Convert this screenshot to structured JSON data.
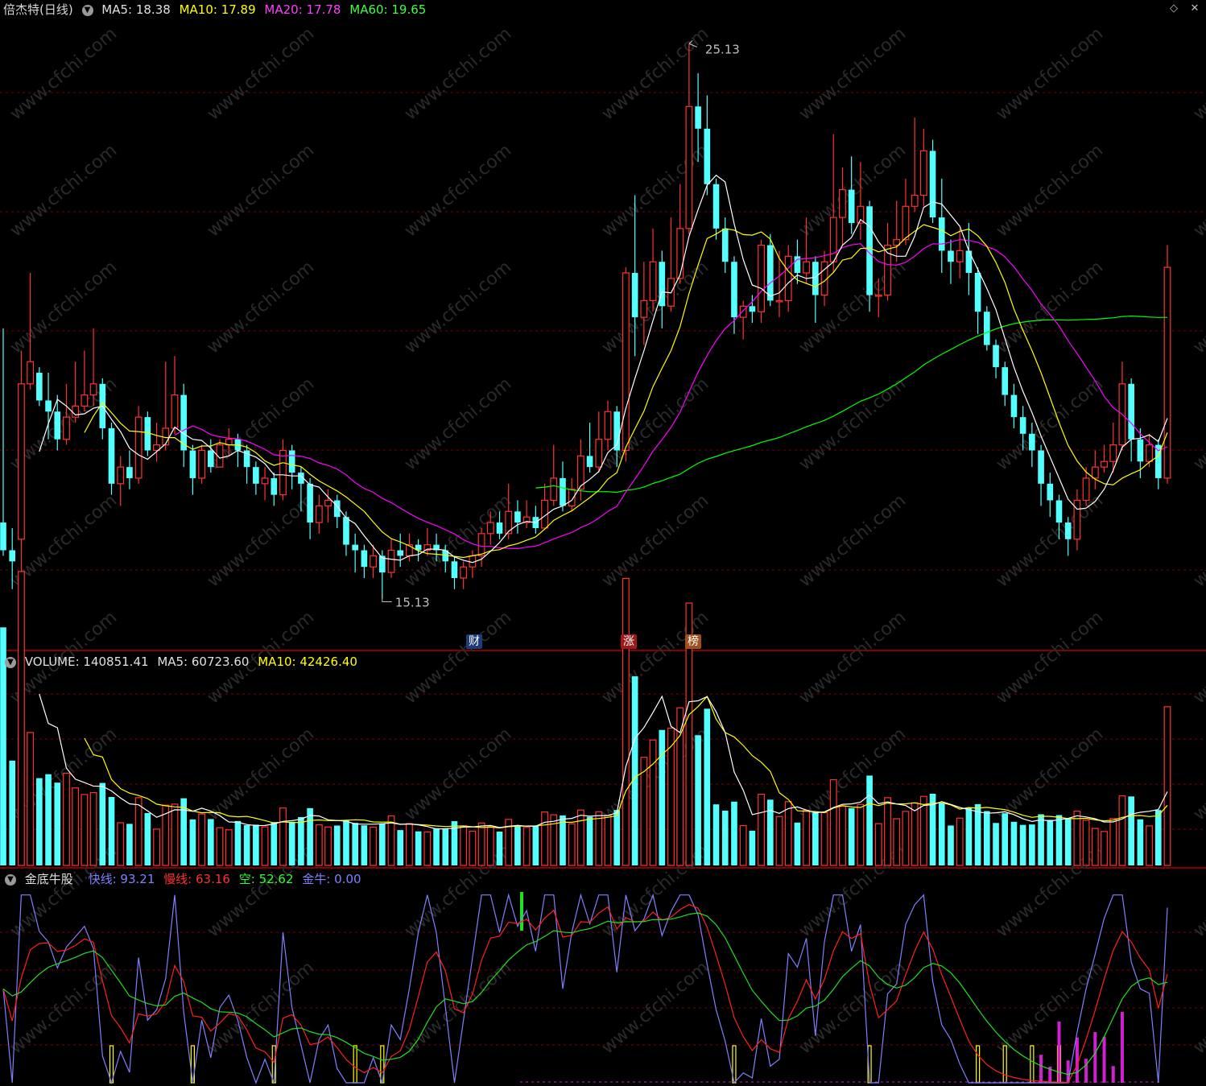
{
  "header": {
    "stock_name": "倍杰特(日线)",
    "ma5": "MA5: 18.38",
    "ma10": "MA10: 17.89",
    "ma20": "MA20: 17.78",
    "ma60": "MA60: 19.65"
  },
  "volume_header": {
    "volume": "VOLUME: 140851.41",
    "ma5": "MA5: 60723.60",
    "ma10": "MA10: 42426.40"
  },
  "indicator_header": {
    "name": "金底牛股",
    "fast_label": "快线:",
    "fast_value": "93.21",
    "slow_label": "慢线:",
    "slow_value": "63.16",
    "empty_label": "空:",
    "empty_value": "52.62",
    "bull_label": "金牛:",
    "bull_value": "0.00"
  },
  "price_labels": {
    "high": "25.13",
    "low": "15.13"
  },
  "event_tags": [
    "财",
    "涨",
    "榜"
  ],
  "watermark": "www.cfchi.com",
  "colors": {
    "up": "#ff3232",
    "down": "#54ffff",
    "ma5": "#ffffff",
    "ma10": "#ffff00",
    "ma20": "#ff00ff",
    "ma60": "#00ff00",
    "grid": "#7a0000",
    "text": "#c0c0c0",
    "fast": "#8080ff",
    "slow": "#ff2020",
    "empty": "#20e020",
    "bull": "#ffff00"
  },
  "chart_data": [
    {
      "type": "candlestick",
      "title": "倍杰特(日线)",
      "max_label": 25.13,
      "min_label": 15.13,
      "candles": [
        [
          16.5,
          16.0,
          20.0,
          15.9
        ],
        [
          16.0,
          15.8,
          16.4,
          15.3
        ],
        [
          16.2,
          19.0,
          19.6,
          15.6
        ],
        [
          19.0,
          19.4,
          21.0,
          18.9
        ],
        [
          19.2,
          18.7,
          19.3,
          18.6
        ],
        [
          18.7,
          18.5,
          19.2,
          18.0
        ],
        [
          18.5,
          18.0,
          18.8,
          17.8
        ],
        [
          18.0,
          18.4,
          19.0,
          17.9
        ],
        [
          18.4,
          18.6,
          19.4,
          18.3
        ],
        [
          18.6,
          18.8,
          19.6,
          18.5
        ],
        [
          18.8,
          19.0,
          20.0,
          18.6
        ],
        [
          19.0,
          18.2,
          19.1,
          18.0
        ],
        [
          18.2,
          17.2,
          18.3,
          17.0
        ],
        [
          17.2,
          17.5,
          17.7,
          16.8
        ],
        [
          17.5,
          17.3,
          17.8,
          17.1
        ],
        [
          17.3,
          18.4,
          18.6,
          17.2
        ],
        [
          18.4,
          17.8,
          18.5,
          17.7
        ],
        [
          17.8,
          17.9,
          18.3,
          17.6
        ],
        [
          17.9,
          18.2,
          19.4,
          17.8
        ],
        [
          18.2,
          18.8,
          19.5,
          18.1
        ],
        [
          18.8,
          17.8,
          19.0,
          17.5
        ],
        [
          17.8,
          17.3,
          17.9,
          17.0
        ],
        [
          17.3,
          17.8,
          17.9,
          17.2
        ],
        [
          17.8,
          17.5,
          18.0,
          17.4
        ],
        [
          17.5,
          17.9,
          18.0,
          17.5
        ],
        [
          17.9,
          18.0,
          18.2,
          17.7
        ],
        [
          18.0,
          17.8,
          18.1,
          17.5
        ],
        [
          17.8,
          17.5,
          17.9,
          17.2
        ],
        [
          17.5,
          17.2,
          17.6,
          17.0
        ],
        [
          17.2,
          17.3,
          17.5,
          16.9
        ],
        [
          17.3,
          17.0,
          17.4,
          16.8
        ],
        [
          17.0,
          17.8,
          18.0,
          16.9
        ],
        [
          17.8,
          17.4,
          17.9,
          17.1
        ],
        [
          17.4,
          17.2,
          17.5,
          16.7
        ],
        [
          17.2,
          16.5,
          17.3,
          16.2
        ],
        [
          16.5,
          16.8,
          17.0,
          16.3
        ],
        [
          16.8,
          16.9,
          17.1,
          16.5
        ],
        [
          16.9,
          16.6,
          17.0,
          16.4
        ],
        [
          16.6,
          16.1,
          16.7,
          15.9
        ],
        [
          16.1,
          16.0,
          16.3,
          15.6
        ],
        [
          16.0,
          15.7,
          16.1,
          15.5
        ],
        [
          15.7,
          15.9,
          16.1,
          15.5
        ],
        [
          15.9,
          15.6,
          16.0,
          15.13
        ],
        [
          15.6,
          16.0,
          16.2,
          15.5
        ],
        [
          16.0,
          15.9,
          16.3,
          15.7
        ],
        [
          15.9,
          16.1,
          16.3,
          15.8
        ],
        [
          16.1,
          16.0,
          16.2,
          15.8
        ],
        [
          16.0,
          16.1,
          16.4,
          15.9
        ],
        [
          16.1,
          16.0,
          16.3,
          15.8
        ],
        [
          16.0,
          15.8,
          16.1,
          15.6
        ],
        [
          15.8,
          15.5,
          15.9,
          15.3
        ],
        [
          15.5,
          15.7,
          15.8,
          15.3
        ],
        [
          15.7,
          15.9,
          16.0,
          15.5
        ],
        [
          15.9,
          16.3,
          16.4,
          15.7
        ],
        [
          16.3,
          16.5,
          16.7,
          16.1
        ],
        [
          16.5,
          16.3,
          16.7,
          16.2
        ],
        [
          16.3,
          16.7,
          17.2,
          16.2
        ],
        [
          16.7,
          16.5,
          16.9,
          16.3
        ],
        [
          16.5,
          16.6,
          16.9,
          16.4
        ],
        [
          16.6,
          16.4,
          16.8,
          16.3
        ],
        [
          16.4,
          16.9,
          17.2,
          16.4
        ],
        [
          16.9,
          17.3,
          17.9,
          16.8
        ],
        [
          17.3,
          16.8,
          17.6,
          16.7
        ],
        [
          16.8,
          17.1,
          17.3,
          16.7
        ],
        [
          17.1,
          17.7,
          18.0,
          16.9
        ],
        [
          17.7,
          17.5,
          18.3,
          17.4
        ],
        [
          17.5,
          18.0,
          18.5,
          17.4
        ],
        [
          18.0,
          18.5,
          18.7,
          17.8
        ],
        [
          18.5,
          17.8,
          18.6,
          17.5
        ],
        [
          17.8,
          21.0,
          21.1,
          17.6
        ],
        [
          21.0,
          20.2,
          22.4,
          19.5
        ],
        [
          20.2,
          20.5,
          21.2,
          19.7
        ],
        [
          20.5,
          21.2,
          21.8,
          20.3
        ],
        [
          21.2,
          20.4,
          21.4,
          20.0
        ],
        [
          20.4,
          20.9,
          22.0,
          20.3
        ],
        [
          20.9,
          21.8,
          22.6,
          20.8
        ],
        [
          21.8,
          24.0,
          25.13,
          21.7
        ],
        [
          24.0,
          23.6,
          24.6,
          23.0
        ],
        [
          23.6,
          22.6,
          24.2,
          22.4
        ],
        [
          22.6,
          21.8,
          22.7,
          21.6
        ],
        [
          21.8,
          21.2,
          22.0,
          21.0
        ],
        [
          21.2,
          20.2,
          21.3,
          19.9
        ],
        [
          20.2,
          20.4,
          20.5,
          19.8
        ],
        [
          20.4,
          20.3,
          20.6,
          20.1
        ],
        [
          20.3,
          21.5,
          21.6,
          20.1
        ],
        [
          21.5,
          20.5,
          21.7,
          20.4
        ],
        [
          20.5,
          20.5,
          21.4,
          20.2
        ],
        [
          20.5,
          21.3,
          21.5,
          20.3
        ],
        [
          21.3,
          21.0,
          21.6,
          20.8
        ],
        [
          21.0,
          21.2,
          22.0,
          20.8
        ],
        [
          21.2,
          20.6,
          21.3,
          20.1
        ],
        [
          20.6,
          21.2,
          21.4,
          20.4
        ],
        [
          21.2,
          22.0,
          23.5,
          21.0
        ],
        [
          22.0,
          22.5,
          22.9,
          21.5
        ],
        [
          22.5,
          21.9,
          23.1,
          21.7
        ],
        [
          21.9,
          22.2,
          23.0,
          21.6
        ],
        [
          22.2,
          20.6,
          22.3,
          20.3
        ],
        [
          20.6,
          20.6,
          20.9,
          20.2
        ],
        [
          20.6,
          21.5,
          21.9,
          20.5
        ],
        [
          21.5,
          21.6,
          22.3,
          21.2
        ],
        [
          21.6,
          22.2,
          22.7,
          21.5
        ],
        [
          22.2,
          22.4,
          23.8,
          22.1
        ],
        [
          22.4,
          23.2,
          23.6,
          22.2
        ],
        [
          23.2,
          22.0,
          23.4,
          21.9
        ],
        [
          22.0,
          21.4,
          22.7,
          21.0
        ],
        [
          21.4,
          21.2,
          21.6,
          20.8
        ],
        [
          21.2,
          21.4,
          21.8,
          20.9
        ],
        [
          21.4,
          21.0,
          21.9,
          20.6
        ],
        [
          21.0,
          20.3,
          21.1,
          19.9
        ],
        [
          20.3,
          19.7,
          20.4,
          19.6
        ],
        [
          19.7,
          19.3,
          19.8,
          19.1
        ],
        [
          19.3,
          18.8,
          19.4,
          18.6
        ],
        [
          18.8,
          18.4,
          19.0,
          18.2
        ],
        [
          18.4,
          18.1,
          18.6,
          17.8
        ],
        [
          18.1,
          17.8,
          18.3,
          17.5
        ],
        [
          17.8,
          17.2,
          17.9,
          16.8
        ],
        [
          17.2,
          16.9,
          17.4,
          16.6
        ],
        [
          16.9,
          16.5,
          17.0,
          16.2
        ],
        [
          16.5,
          16.2,
          16.6,
          15.9
        ],
        [
          16.2,
          16.9,
          17.1,
          16.0
        ],
        [
          16.9,
          17.3,
          17.5,
          16.8
        ],
        [
          17.3,
          17.5,
          17.8,
          17.1
        ],
        [
          17.5,
          17.6,
          17.9,
          17.4
        ],
        [
          17.6,
          17.9,
          18.3,
          17.4
        ],
        [
          17.9,
          19.0,
          19.4,
          17.8
        ],
        [
          19.0,
          18.0,
          19.1,
          17.6
        ],
        [
          18.0,
          17.6,
          18.2,
          17.3
        ],
        [
          17.6,
          17.9,
          18.1,
          17.5
        ],
        [
          17.9,
          17.3,
          18.0,
          17.1
        ],
        [
          17.3,
          21.1,
          21.5,
          17.2
        ]
      ],
      "ma5_last": 18.38,
      "ma10_last": 17.89,
      "ma20_last": 17.78,
      "ma60_last": 19.65
    },
    {
      "type": "bar",
      "title": "VOLUME",
      "last_value": 140851.41,
      "ma5_last": 60723.6,
      "ma10_last": 42426.4
    },
    {
      "type": "line",
      "title": "金底牛股",
      "series": [
        {
          "name": "快线",
          "last": 93.21
        },
        {
          "name": "慢线",
          "last": 63.16
        },
        {
          "name": "空",
          "last": 52.62
        },
        {
          "name": "金牛",
          "last": 0.0
        }
      ]
    }
  ]
}
